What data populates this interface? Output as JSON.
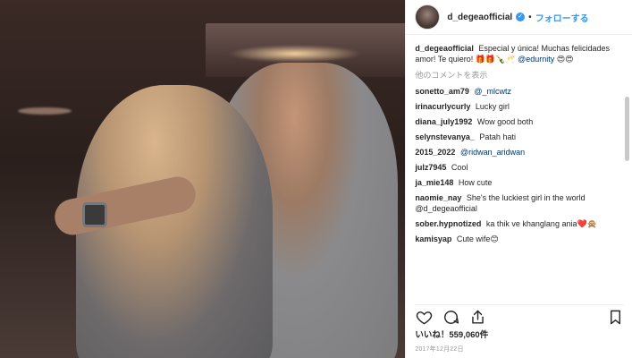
{
  "header": {
    "username": "d_degeaofficial",
    "separator": "•",
    "follow_label": "フォローする"
  },
  "caption": {
    "username": "d_degeaofficial",
    "text": "Especial y única! Muchas felicidades amor! Te quiero! 🎁🎁🍾🥂",
    "mention": "@edurnity",
    "emoji": "😍😍"
  },
  "more_comments_label": "他のコメントを表示",
  "comments": [
    {
      "user": "sonetto_am79",
      "text": "@_mlcwtz"
    },
    {
      "user": "irinacurlycurly",
      "text": "Lucky girl"
    },
    {
      "user": "diana_july1992",
      "text": "Wow good both"
    },
    {
      "user": "selynstevanya_",
      "text": "Patah hati"
    },
    {
      "user": "2015_2022",
      "text": "@ridwan_aridwan"
    },
    {
      "user": "julz7945",
      "text": "Cool"
    },
    {
      "user": "ja_mie148",
      "text": "How cute"
    },
    {
      "user": "naomie_nay",
      "text": "She's the luckiest girl in the world @d_degeaofficial"
    },
    {
      "user": "sober.hypnotized",
      "text": "ka thik ve khanglang ania❤️🙊"
    },
    {
      "user": "kamisyap",
      "text": "Cute wife😊"
    }
  ],
  "likes_text": "いいね！559,060件",
  "date_text": "2017年12月22日",
  "icons": {
    "like": "heart-icon",
    "comment": "comment-icon",
    "share": "share-icon",
    "save": "bookmark-icon",
    "verified": "verified-badge-icon"
  },
  "colors": {
    "accent": "#3897f0",
    "text": "#262626",
    "muted": "#999999"
  }
}
